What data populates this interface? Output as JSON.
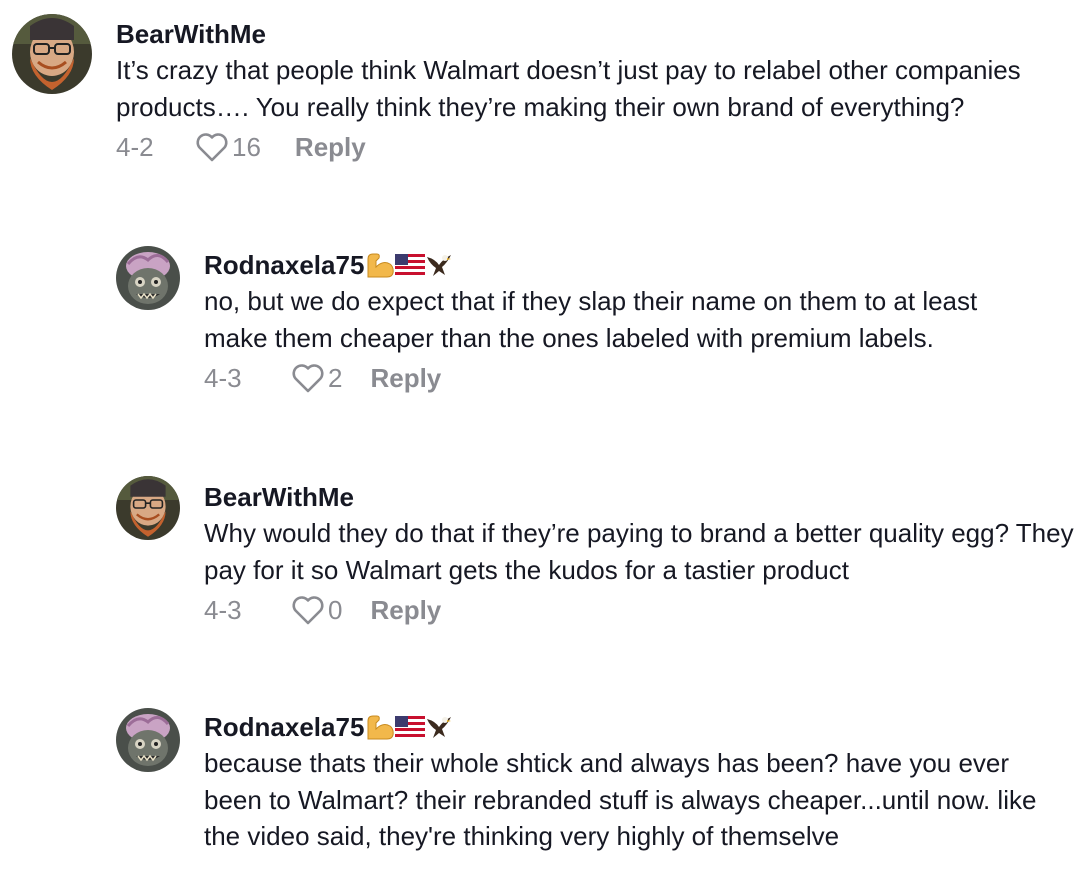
{
  "comments": [
    {
      "username": "BearWithMe",
      "text": "It’s crazy that people think Walmart doesn’t just pay to relabel other companies products…. You really think they’re making their own brand of everything?",
      "date": "4-2",
      "likes": "16",
      "reply_label": "Reply",
      "avatar": "bearded-man-avatar"
    },
    {
      "username": "Rodnaxela75",
      "text": "no, but we do expect that if they slap their name on them to at least make them cheaper than the ones labeled with premium labels.",
      "date": "4-3",
      "likes": "2",
      "reply_label": "Reply",
      "avatar": "monster-mask-avatar",
      "emojis": [
        "flexed-biceps-icon",
        "us-flag-icon",
        "eagle-icon"
      ]
    },
    {
      "username": "BearWithMe",
      "text": "Why would they do that if they’re paying to brand a better quality egg? They pay for it so Walmart gets the kudos for a tastier product",
      "date": "4-3",
      "likes": "0",
      "reply_label": "Reply",
      "avatar": "bearded-man-avatar"
    },
    {
      "username": "Rodnaxela75",
      "text": "because thats their whole shtick and always has been? have you ever been to Walmart? their rebranded stuff is always cheaper...until now. like the video said, they're thinking very highly of themselve",
      "avatar": "monster-mask-avatar",
      "emojis": [
        "flexed-biceps-icon",
        "us-flag-icon",
        "eagle-icon"
      ]
    }
  ],
  "colors": {
    "text": "#161823",
    "muted": "#8a8b91",
    "background": "#ffffff"
  }
}
